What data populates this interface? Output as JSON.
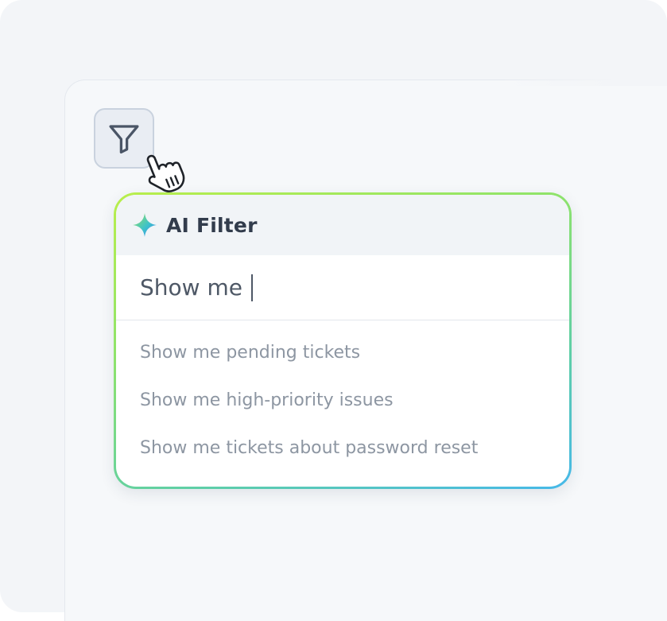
{
  "filter_button": {
    "icon": "filter-icon"
  },
  "cursor": {
    "icon": "hand-pointer-icon"
  },
  "ai_filter": {
    "icon": "sparkle-icon",
    "title": "AI Filter",
    "query_value": "Show me ",
    "suggestions": [
      "Show me pending tickets",
      "Show me high-priority issues",
      "Show me tickets about password reset"
    ]
  },
  "colors": {
    "border_gradient_start": "#b9ee4b",
    "border_gradient_end": "#46b8ea",
    "sparkle_start": "#9be15d",
    "sparkle_end": "#3b82f6"
  }
}
